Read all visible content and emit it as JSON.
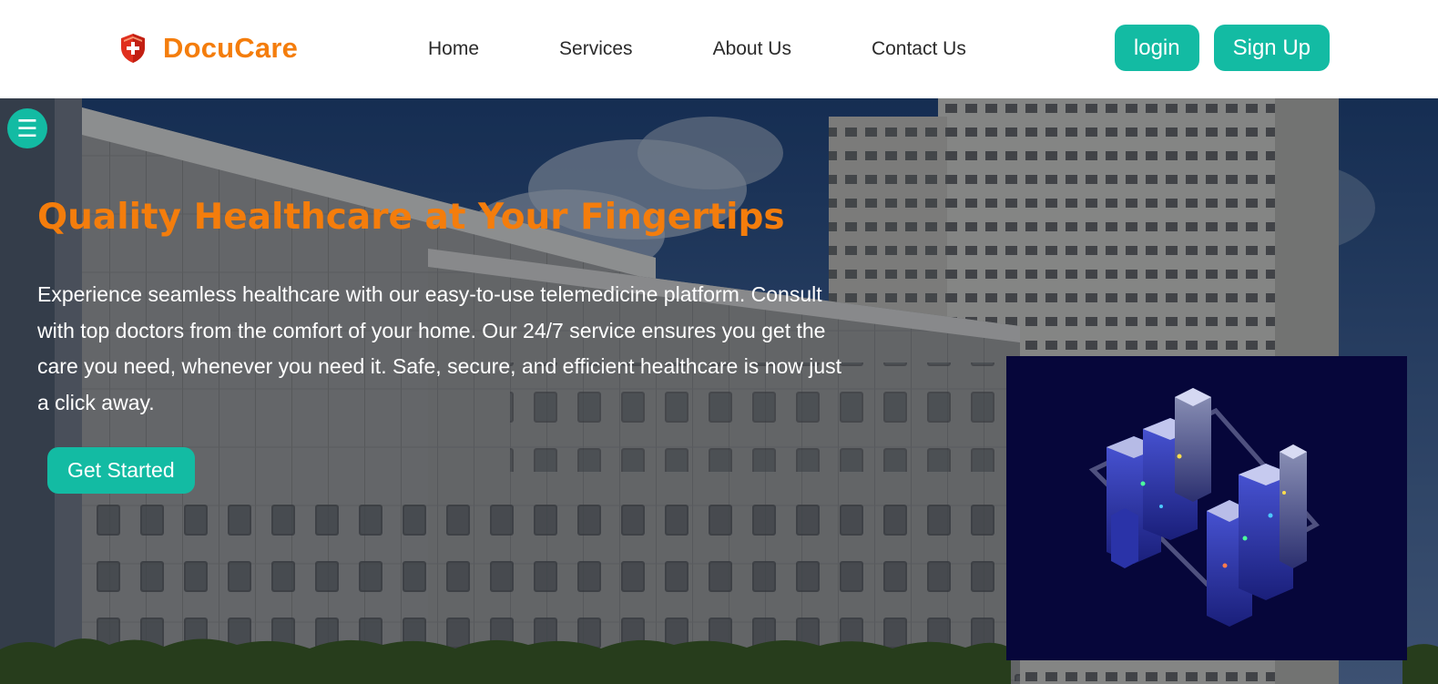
{
  "brand": {
    "name": "DocuCare",
    "color": "#f47d0c"
  },
  "nav": {
    "items": [
      "Home",
      "Services",
      "About Us",
      "Contact Us"
    ]
  },
  "auth": {
    "login_label": "login",
    "signup_label": "Sign Up"
  },
  "hero": {
    "title": "Quality Healthcare at Your Fingertips",
    "description": "Experience seamless healthcare with our easy-to-use telemedicine platform. Consult with top doctors from the comfort of your home. Our 24/7 service ensures you get the care you need, whenever you need it. Safe, secure, and efficient healthcare is now just a click away.",
    "cta_label": "Get Started"
  },
  "icons": {
    "logo": "shield-medical-icon",
    "menu": "hamburger-menu-icon"
  },
  "colors": {
    "accent": "#13bba3",
    "brand_orange": "#f47d0c",
    "art_background": "#06063a"
  }
}
